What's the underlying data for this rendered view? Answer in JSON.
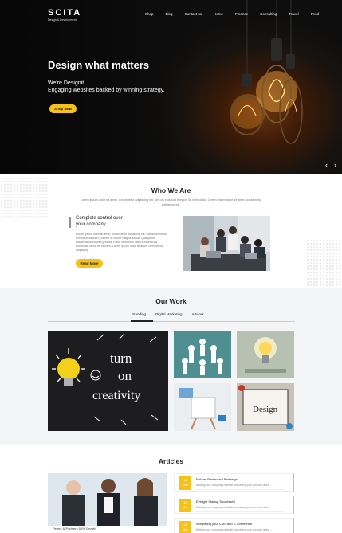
{
  "brand": {
    "name": "SCITA",
    "tagline": "Design & Development"
  },
  "nav": [
    "Shop",
    "Blog",
    "Contact us",
    "Home",
    "Finance",
    "Consulting",
    "Travel",
    "Food"
  ],
  "hero": {
    "title": "Design what matters",
    "line1": "We're Designit",
    "line2": "Engaging websites backed by winning strategy.",
    "button": "Shop Now",
    "prev": "‹",
    "next": "›"
  },
  "who": {
    "title": "Who We Are",
    "intro": "Lorem ipsum dolor sit amet, consectetur adipiscing elit, sed do eiusmod tempor. Sit in mi dolor. Lorem ipsum dolor sit amet, consectetur adipiscing elit.",
    "heading_1": "Complete control over",
    "heading_2": "your company.",
    "body": "Lorem ipsum dolor sit amet, consectetur adipiscing elit, sed do eiusmod tempor incididunt ut labore et dolore magna aliqua. Quis ipsum suspendisse ultrices gravida. Risus commodo viverra maecenas accumsan lacus vel facilisis. Lorem ipsum dolor sit amet, consectetur adipiscing.",
    "button": "Read More"
  },
  "work": {
    "title": "Our Work",
    "tabs": [
      "Branding",
      "Digital Marketing",
      "Artwork"
    ],
    "chalk_1": "turn",
    "chalk_2": "on",
    "chalk_3": "creativity",
    "board_text": "Design"
  },
  "articles": {
    "title": "Articles",
    "feature_caption": "Peters & Partners 50% Growth",
    "items": [
      {
        "day": "12",
        "month": "May",
        "title": "Fishnet Restaurant Redesign",
        "desc": "Building your company's website and setting your products online ..."
      },
      {
        "day": "13",
        "month": "May",
        "title": "Eyelight Startup Successful",
        "desc": "Building your company's website and setting your products online ..."
      },
      {
        "day": "14",
        "month": "May",
        "title": "Integrating your CMS and E-Commerce",
        "desc": "Building your company's website and setting your products online ..."
      }
    ]
  },
  "colors": {
    "accent": "#f4c21a",
    "hero_dark": "#0e0e0e",
    "section_gray": "#f4f5f7"
  }
}
